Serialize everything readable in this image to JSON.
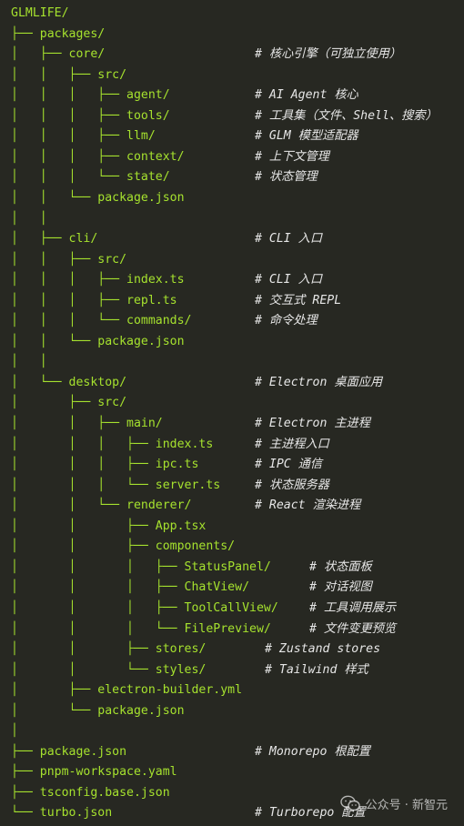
{
  "colors": {
    "background": "#272822",
    "path_text": "#a6e22e",
    "comment_text": "#e6e6e6"
  },
  "tree_lines": [
    {
      "path": "GLMLIFE/",
      "comment": ""
    },
    {
      "path": "├── packages/",
      "comment": ""
    },
    {
      "path": "│   ├── core/",
      "comment": "# 核心引擎（可独立使用）"
    },
    {
      "path": "│   │   ├── src/",
      "comment": ""
    },
    {
      "path": "│   │   │   ├── agent/",
      "comment": "# AI Agent 核心"
    },
    {
      "path": "│   │   │   ├── tools/",
      "comment": "# 工具集（文件、Shell、搜索）"
    },
    {
      "path": "│   │   │   ├── llm/",
      "comment": "# GLM 模型适配器"
    },
    {
      "path": "│   │   │   ├── context/",
      "comment": "# 上下文管理"
    },
    {
      "path": "│   │   │   └── state/",
      "comment": "# 状态管理"
    },
    {
      "path": "│   │   └── package.json",
      "comment": ""
    },
    {
      "path": "│   │",
      "comment": ""
    },
    {
      "path": "│   ├── cli/",
      "comment": "# CLI 入口"
    },
    {
      "path": "│   │   ├── src/",
      "comment": ""
    },
    {
      "path": "│   │   │   ├── index.ts",
      "comment": "# CLI 入口"
    },
    {
      "path": "│   │   │   ├── repl.ts",
      "comment": "# 交互式 REPL"
    },
    {
      "path": "│   │   │   └── commands/",
      "comment": "# 命令处理"
    },
    {
      "path": "│   │   └── package.json",
      "comment": ""
    },
    {
      "path": "│   │",
      "comment": ""
    },
    {
      "path": "│   └── desktop/",
      "comment": "# Electron 桌面应用"
    },
    {
      "path": "│       ├── src/",
      "comment": ""
    },
    {
      "path": "│       │   ├── main/",
      "comment": "# Electron 主进程"
    },
    {
      "path": "│       │   │   ├── index.ts",
      "comment": "# 主进程入口"
    },
    {
      "path": "│       │   │   ├── ipc.ts",
      "comment": "# IPC 通信"
    },
    {
      "path": "│       │   │   └── server.ts",
      "comment": "# 状态服务器"
    },
    {
      "path": "│       │   └── renderer/",
      "comment": "# React 渲染进程"
    },
    {
      "path": "│       │       ├── App.tsx",
      "comment": ""
    },
    {
      "path": "│       │       ├── components/",
      "comment": ""
    },
    {
      "path": "│       │       │   ├── StatusPanel/",
      "comment": "# 状态面板"
    },
    {
      "path": "│       │       │   ├── ChatView/",
      "comment": "# 对话视图"
    },
    {
      "path": "│       │       │   ├── ToolCallView/",
      "comment": "# 工具调用展示"
    },
    {
      "path": "│       │       │   └── FilePreview/",
      "comment": "# 文件变更预览"
    },
    {
      "path": "│       │       ├── stores/",
      "comment": "# Zustand stores"
    },
    {
      "path": "│       │       └── styles/",
      "comment": "# Tailwind 样式"
    },
    {
      "path": "│       ├── electron-builder.yml",
      "comment": ""
    },
    {
      "path": "│       └── package.json",
      "comment": ""
    },
    {
      "path": "│",
      "comment": ""
    },
    {
      "path": "├── package.json",
      "comment": "# Monorepo 根配置"
    },
    {
      "path": "├── pnpm-workspace.yaml",
      "comment": ""
    },
    {
      "path": "├── tsconfig.base.json",
      "comment": ""
    },
    {
      "path": "└── turbo.json",
      "comment": "# Turborepo 配置"
    }
  ],
  "watermark": {
    "icon": "wechat-icon",
    "text": "公众号 · 新智元"
  }
}
